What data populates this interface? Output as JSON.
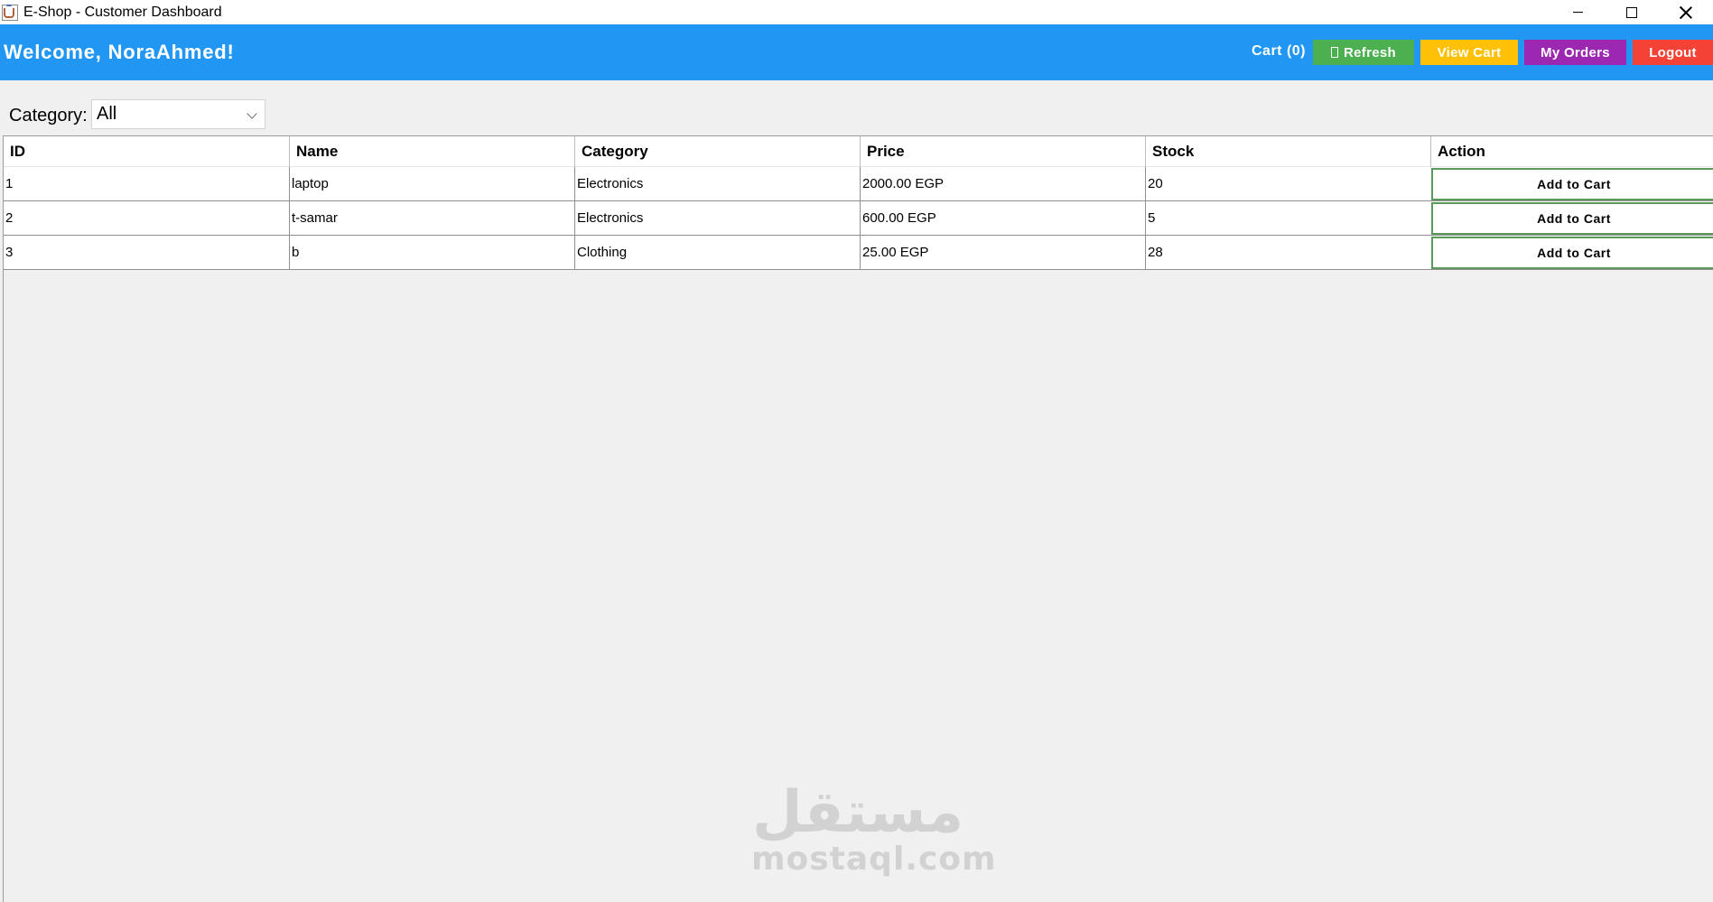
{
  "window": {
    "title": "E-Shop - Customer Dashboard"
  },
  "header": {
    "welcome": "Welcome, NoraAhmed!",
    "cart_label": "Cart (0)",
    "refresh_label": "Refresh",
    "view_cart_label": "View Cart",
    "my_orders_label": "My Orders",
    "logout_label": "Logout",
    "colors": {
      "header_bg": "#2196f3",
      "refresh": "#4caf50",
      "view_cart": "#ffc107",
      "my_orders": "#9c27b0",
      "logout": "#f44336"
    }
  },
  "filter": {
    "label": "Category:",
    "selected": "All"
  },
  "table": {
    "columns": [
      "ID",
      "Name",
      "Category",
      "Price",
      "Stock",
      "Action"
    ],
    "rows": [
      {
        "id": "1",
        "name": "laptop",
        "category": "Electronics",
        "price": "2000.00 EGP",
        "stock": "20",
        "action": "Add to Cart"
      },
      {
        "id": "2",
        "name": "t-samar",
        "category": "Electronics",
        "price": "600.00 EGP",
        "stock": "5",
        "action": "Add to Cart"
      },
      {
        "id": "3",
        "name": "b",
        "category": "Clothing",
        "price": "25.00 EGP",
        "stock": "28",
        "action": "Add to Cart"
      }
    ]
  },
  "watermark": {
    "arabic": "مستقل",
    "latin": "mostaql.com"
  }
}
